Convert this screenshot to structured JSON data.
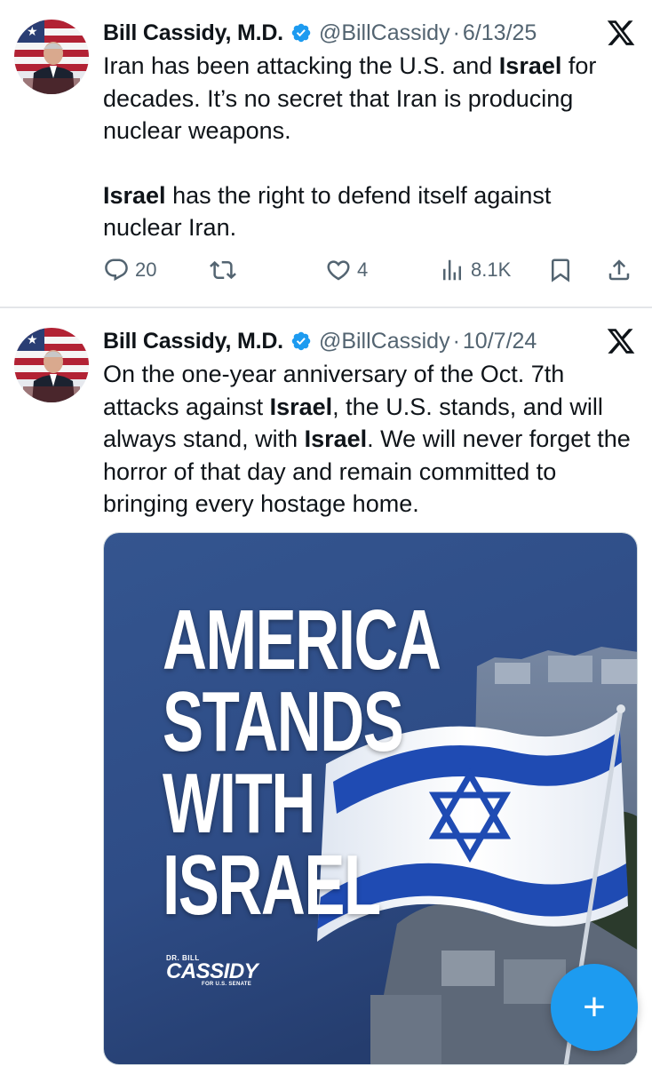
{
  "tweets": [
    {
      "author_name": "Bill Cassidy, M.D.",
      "handle": "@BillCassidy",
      "separator": "·",
      "date": "6/13/25",
      "text": {
        "p1_a": "Iran has been attacking the U.S. and ",
        "p1_b": "Israel",
        "p1_c": " for decades.  It’s no secret that Iran is producing nuclear weapons.",
        "p2_a": "Israel",
        "p2_b": " has the right to defend itself against nuclear Iran."
      },
      "metrics": {
        "replies": "20",
        "reposts": "",
        "likes": "4",
        "views": "8.1K"
      }
    },
    {
      "author_name": "Bill Cassidy, M.D.",
      "handle": "@BillCassidy",
      "separator": "·",
      "date": "10/7/24",
      "text": {
        "a": "On the one-year anniversary of the Oct. 7th attacks against ",
        "b": "Israel",
        "c": ", the U.S. stands, and will always stand, with ",
        "d": "Israel",
        "e": ". We will never forget the horror of that day and remain committed to bringing every hostage home."
      },
      "media": {
        "headline": [
          "AMERICA",
          "STANDS",
          "WITH",
          "ISRAEL"
        ],
        "logo_line1": "DR. BILL",
        "logo_line2": "CASSIDY",
        "logo_line3": "FOR U.S. SENATE"
      }
    }
  ],
  "icons": {
    "reply": "reply-icon",
    "repost": "repost-icon",
    "like": "heart-icon",
    "views": "views-icon",
    "bookmark": "bookmark-icon",
    "share": "share-icon",
    "platform": "x-logo-icon",
    "verified": "verified-badge-icon"
  },
  "fab": {
    "label": "+"
  },
  "colors": {
    "accent": "#1d9bf0",
    "muted": "#536471",
    "text": "#0f1419"
  }
}
